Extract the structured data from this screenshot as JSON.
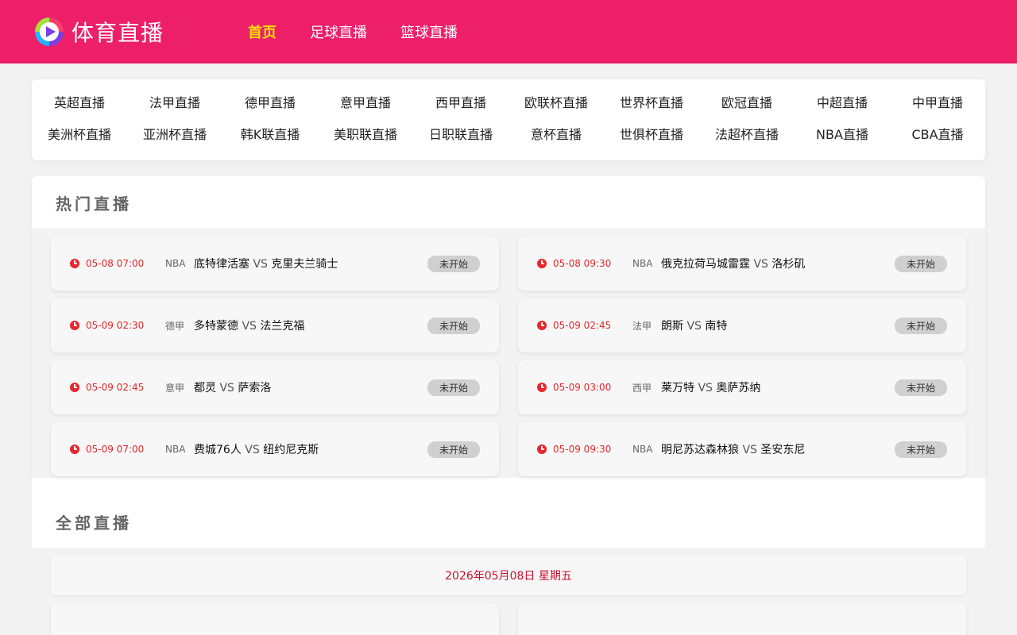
{
  "header": {
    "logo_text": "体育直播",
    "nav": [
      {
        "label": "首页",
        "active": true
      },
      {
        "label": "足球直播",
        "active": false
      },
      {
        "label": "篮球直播",
        "active": false
      }
    ]
  },
  "leagues": {
    "row1": [
      "英超直播",
      "法甲直播",
      "德甲直播",
      "意甲直播",
      "西甲直播",
      "欧联杯直播",
      "世界杯直播",
      "欧冠直播",
      "中超直播",
      "中甲直播"
    ],
    "row2": [
      "美洲杯直播",
      "亚洲杯直播",
      "韩K联直播",
      "美职联直播",
      "日职联直播",
      "意杯直播",
      "世俱杯直播",
      "法超杯直播",
      "NBA直播",
      "CBA直播"
    ]
  },
  "hot": {
    "title": "热门直播",
    "matches": [
      {
        "time": "05-08 07:00",
        "league": "NBA",
        "home": "底特律活塞",
        "vs": "VS",
        "away": "克里夫兰骑士",
        "status": "未开始"
      },
      {
        "time": "05-08 09:30",
        "league": "NBA",
        "home": "俄克拉荷马城雷霆",
        "vs": "VS",
        "away": "洛杉矶",
        "status": "未开始"
      },
      {
        "time": "05-09 02:30",
        "league": "德甲",
        "home": "多特蒙德",
        "vs": "VS",
        "away": "法兰克福",
        "status": "未开始"
      },
      {
        "time": "05-09 02:45",
        "league": "法甲",
        "home": "朗斯",
        "vs": "VS",
        "away": "南特",
        "status": "未开始"
      },
      {
        "time": "05-09 02:45",
        "league": "意甲",
        "home": "都灵",
        "vs": "VS",
        "away": "萨索洛",
        "status": "未开始"
      },
      {
        "time": "05-09 03:00",
        "league": "西甲",
        "home": "莱万特",
        "vs": "VS",
        "away": "奥萨苏纳",
        "status": "未开始"
      },
      {
        "time": "05-09 07:00",
        "league": "NBA",
        "home": "费城76人",
        "vs": "VS",
        "away": "纽约尼克斯",
        "status": "未开始"
      },
      {
        "time": "05-09 09:30",
        "league": "NBA",
        "home": "明尼苏达森林狼",
        "vs": "VS",
        "away": "圣安东尼",
        "status": "未开始"
      }
    ]
  },
  "all": {
    "title": "全部直播",
    "date": "2026年05月08日 星期五"
  },
  "colors": {
    "header_bg": "#ec1f68",
    "nav_active": "#ffe100",
    "time_red": "#e8262b",
    "date_red": "#c8102e"
  }
}
